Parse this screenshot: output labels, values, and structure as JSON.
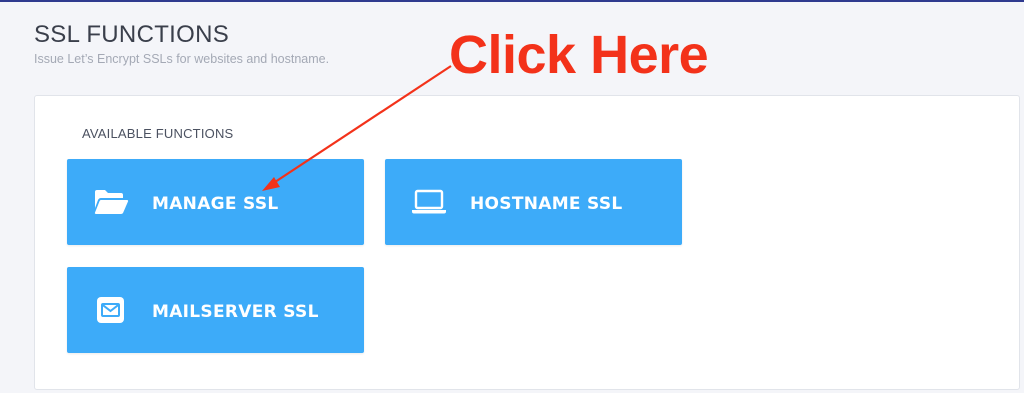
{
  "header": {
    "title": "SSL FUNCTIONS",
    "subtitle": "Issue Let’s Encrypt SSLs for websites and hostname."
  },
  "panel": {
    "section_label": "AVAILABLE FUNCTIONS",
    "functions": [
      {
        "label": "MANAGE SSL",
        "icon": "folder-open-icon"
      },
      {
        "label": "HOSTNAME SSL",
        "icon": "laptop-icon"
      },
      {
        "label": "MAILSERVER SSL",
        "icon": "mail-icon"
      }
    ]
  },
  "annotation": {
    "text": "Click Here",
    "color": "#f3321a"
  },
  "colors": {
    "button_bg": "#3dabf9",
    "top_border": "#2f3a8f",
    "page_bg": "#f4f5f9"
  }
}
